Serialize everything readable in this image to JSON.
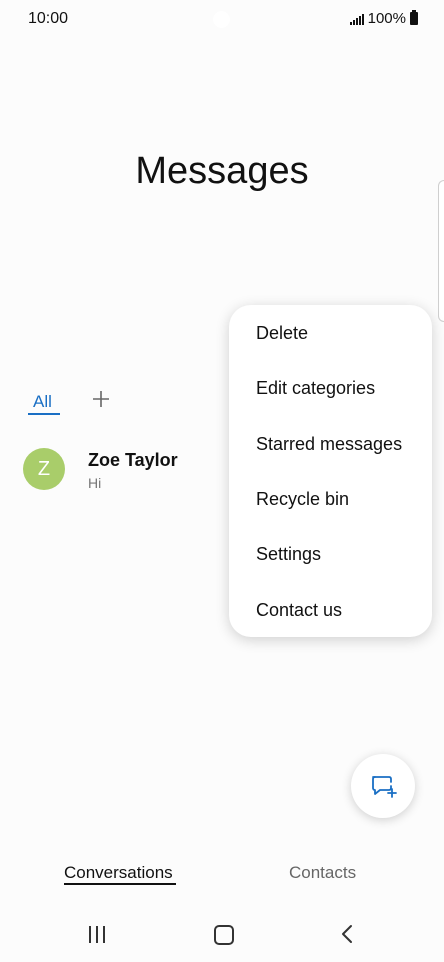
{
  "status_bar": {
    "time": "10:00",
    "battery_percent": "100%"
  },
  "page": {
    "title": "Messages"
  },
  "categories": {
    "active_tab": "All",
    "add_icon": "plus-icon"
  },
  "conversations": [
    {
      "avatar_letter": "Z",
      "name": "Zoe Taylor",
      "preview": "Hi",
      "avatar_color": "#a9cd6a"
    }
  ],
  "context_menu": {
    "items": [
      "Delete",
      "Edit categories",
      "Starred messages",
      "Recycle bin",
      "Settings",
      "Contact us"
    ]
  },
  "fab": {
    "icon": "compose-message-icon"
  },
  "bottom_tabs": {
    "conversations": "Conversations",
    "contacts": "Contacts"
  },
  "navigation": {
    "recents_icon": "recents-icon",
    "home_icon": "home-icon",
    "back_icon": "back-icon"
  },
  "colors": {
    "accent": "#1a6fc4",
    "avatar": "#a9cd6a",
    "background": "#fcfcfc"
  }
}
